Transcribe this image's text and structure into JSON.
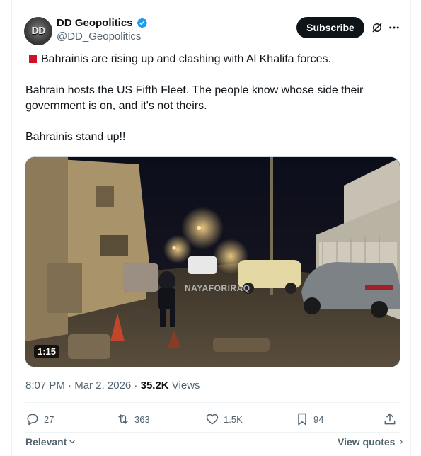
{
  "author": {
    "display_name": "DD Geopolitics",
    "handle": "@DD_Geopolitics",
    "avatar_text": "DD",
    "verified": true
  },
  "header": {
    "subscribe_label": "Subscribe",
    "icons": [
      "grok-icon",
      "more-icon"
    ]
  },
  "tweet": {
    "line1": "Bahrainis are rising up and clashing with Al Khalifa forces.",
    "line2": "Bahrain hosts the US Fifth Fleet. The people know whose side their government is on, and it's not theirs.",
    "line3": "Bahrainis stand up!!",
    "flag": "bahrain-flag"
  },
  "media": {
    "duration": "1:15",
    "watermark": "NAYAFORIRAQ"
  },
  "meta": {
    "time": "8:07 PM",
    "separator": " · ",
    "date": "Mar 2, 2026",
    "views_count": "35.2K",
    "views_label": " Views"
  },
  "actions": {
    "replies": "27",
    "reposts": "363",
    "likes": "1.5K",
    "bookmarks": "94"
  },
  "footer": {
    "sort_label": "Relevant",
    "view_quotes_label": "View quotes"
  },
  "colors": {
    "text": "#0f1419",
    "secondary": "#536471",
    "verified_blue": "#1d9bf0",
    "button_dark": "#0f1419"
  }
}
